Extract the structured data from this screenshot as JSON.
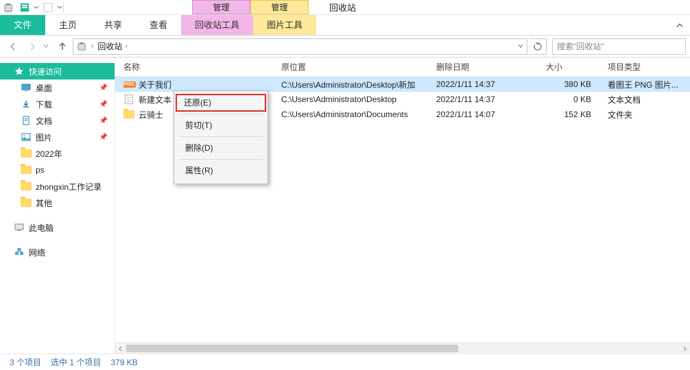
{
  "window": {
    "title": "回收站",
    "title_tabs": [
      {
        "label": "管理",
        "style": "pink"
      },
      {
        "label": "管理",
        "style": "yellow"
      }
    ]
  },
  "ribbon": {
    "file": "文件",
    "home": "主页",
    "share": "共享",
    "view": "查看",
    "recycle_tools": "回收站工具",
    "picture_tools": "图片工具"
  },
  "breadcrumb": {
    "location": "回收站"
  },
  "search": {
    "placeholder": "搜索\"回收站\""
  },
  "sidebar": {
    "items": [
      {
        "label": "快速访问",
        "active": true,
        "pin": false
      },
      {
        "label": "桌面",
        "indent": true,
        "pin": true,
        "icon": "desktop"
      },
      {
        "label": "下载",
        "indent": true,
        "pin": true,
        "icon": "download"
      },
      {
        "label": "文档",
        "indent": true,
        "pin": true,
        "icon": "document"
      },
      {
        "label": "图片",
        "indent": true,
        "pin": true,
        "icon": "picture"
      },
      {
        "label": "2022年",
        "indent": true,
        "pin": false,
        "icon": "folder"
      },
      {
        "label": "ps",
        "indent": true,
        "pin": false,
        "icon": "folder"
      },
      {
        "label": "zhongxin工作记录",
        "indent": true,
        "pin": false,
        "icon": "folder"
      },
      {
        "label": "其他",
        "indent": true,
        "pin": false,
        "icon": "folder"
      }
    ],
    "this_pc": "此电脑",
    "network": "网络"
  },
  "columns": {
    "name": "名称",
    "orig": "原位置",
    "date": "删除日期",
    "size": "大小",
    "type": "项目类型"
  },
  "rows": [
    {
      "name": "关于我们",
      "orig": "C:\\Users\\Administrator\\Desktop\\新加",
      "date": "2022/1/11 14:37",
      "size": "380 KB",
      "type": "看图王 PNG 图片...",
      "icon": "png",
      "selected": true
    },
    {
      "name": "新建文本",
      "orig": "C:\\Users\\Administrator\\Desktop",
      "date": "2022/1/11 14:37",
      "size": "0 KB",
      "type": "文本文档",
      "icon": "txt",
      "selected": false
    },
    {
      "name": "云骑士",
      "orig": "C:\\Users\\Administrator\\Documents",
      "date": "2022/1/11 14:07",
      "size": "152 KB",
      "type": "文件夹",
      "icon": "folder",
      "selected": false
    }
  ],
  "context_menu": {
    "restore": "还原(E)",
    "cut": "剪切(T)",
    "delete": "删除(D)",
    "properties": "属性(R)"
  },
  "status": {
    "items": "3 个项目",
    "selected": "选中 1 个项目",
    "size": "379 KB"
  }
}
